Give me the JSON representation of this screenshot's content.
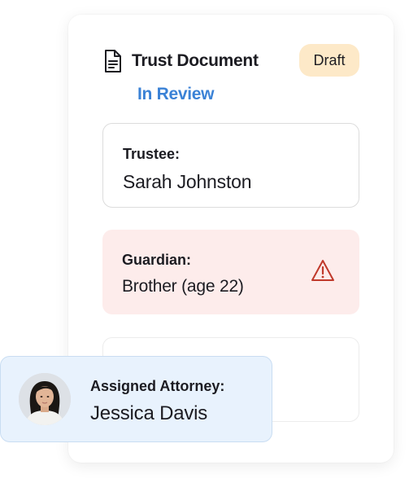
{
  "document": {
    "title": "Trust Document",
    "badge": "Draft",
    "status": "In Review",
    "icon": "document-icon"
  },
  "fields": [
    {
      "label": "Trustee:",
      "value": "Sarah Johnston"
    },
    {
      "label": "Guardian:",
      "value": "Brother (age 22)",
      "icon": "warning-icon"
    }
  ],
  "attorney": {
    "label": "Assigned Attorney:",
    "name": "Jessica Davis",
    "avatar": "avatar-photo"
  },
  "colors": {
    "badge_bg": "#fde9c8",
    "status": "#3b82d6",
    "warning_bg": "#fdeceb",
    "warning_icon": "#c0392b",
    "attorney_bg": "#e8f2fd"
  }
}
